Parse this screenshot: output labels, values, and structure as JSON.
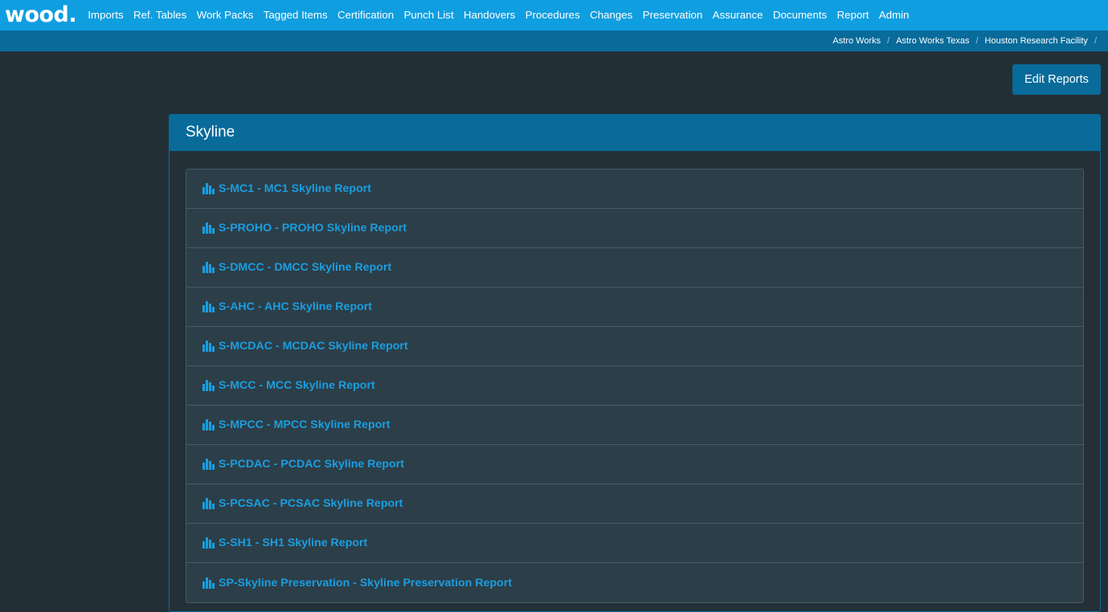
{
  "brand": {
    "logo": "wood."
  },
  "nav": {
    "items": [
      "Imports",
      "Ref. Tables",
      "Work Packs",
      "Tagged Items",
      "Certification",
      "Punch List",
      "Handovers",
      "Procedures",
      "Changes",
      "Preservation",
      "Assurance",
      "Documents",
      "Report",
      "Admin"
    ]
  },
  "breadcrumb": {
    "items": [
      "Astro Works",
      "Astro Works Texas",
      "Houston Research Facility"
    ]
  },
  "toolbar": {
    "edit_reports_label": "Edit Reports"
  },
  "panel": {
    "title": "Skyline",
    "reports": [
      "S-MC1 - MC1 Skyline Report",
      "S-PROHO - PROHO Skyline Report",
      "S-DMCC - DMCC Skyline Report",
      "S-AHC - AHC Skyline Report",
      "S-MCDAC - MCDAC Skyline Report",
      "S-MCC - MCC Skyline Report",
      "S-MPCC - MPCC Skyline Report",
      "S-PCDAC - PCDAC Skyline Report",
      "S-PCSAC - PCSAC Skyline Report",
      "S-SH1 - SH1 Skyline Report",
      "SP-Skyline Preservation - Skyline Preservation Report"
    ],
    "report_icon": "bar-chart-icon"
  },
  "colors": {
    "nav_bg": "#0f9ee0",
    "breadcrumb_bg": "#086b9a",
    "page_bg": "#232f36",
    "link": "#1a9ee0"
  }
}
